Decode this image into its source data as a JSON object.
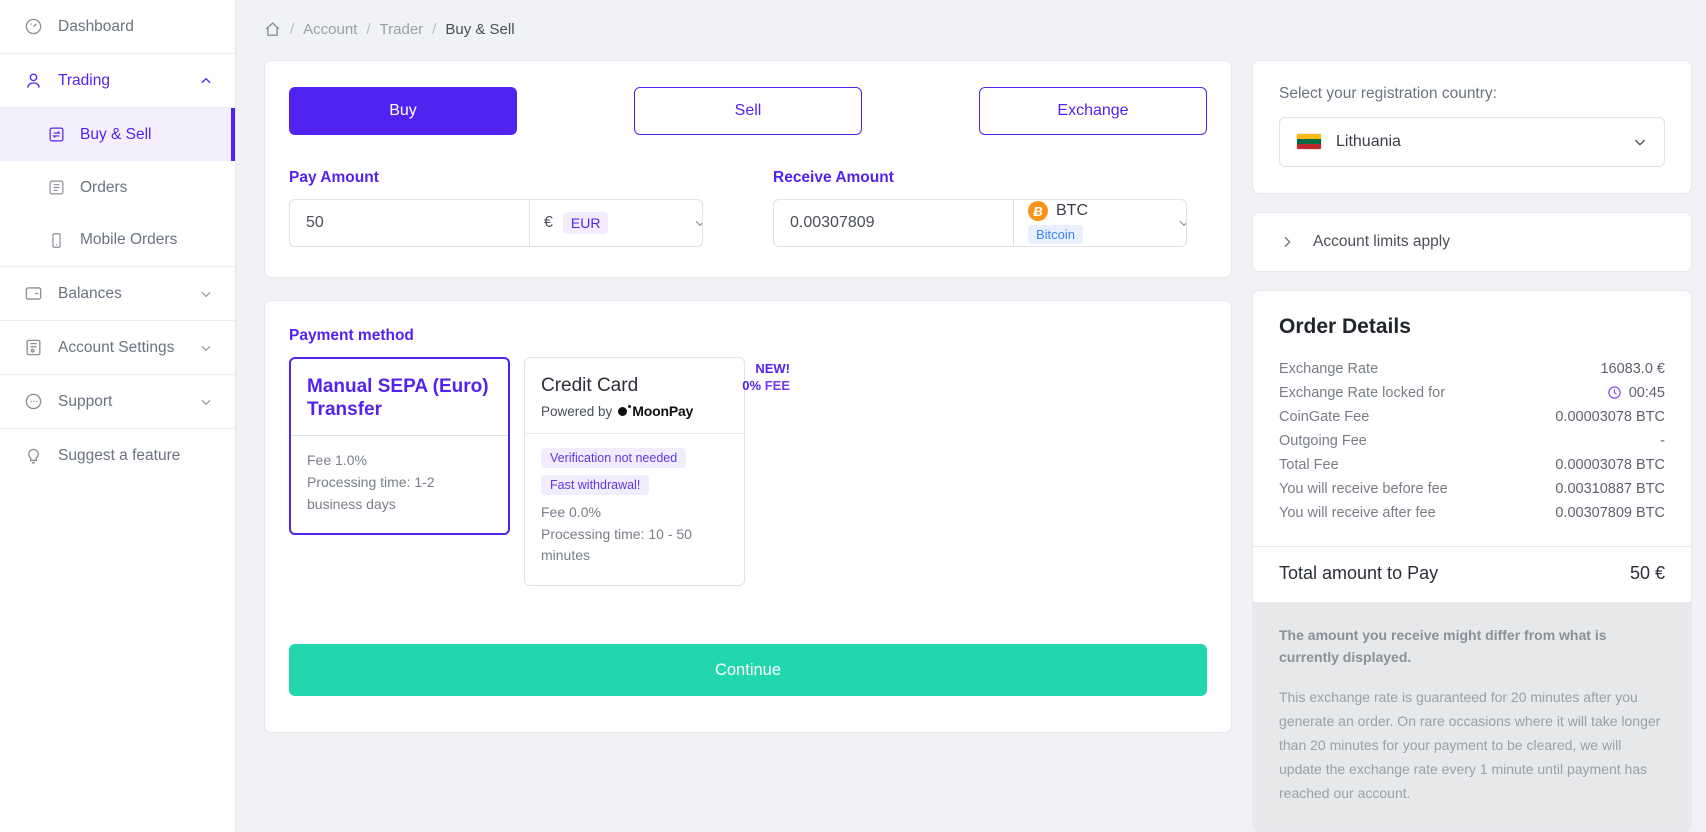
{
  "sidebar": {
    "items": [
      {
        "label": "Dashboard",
        "icon": "gauge-icon",
        "type": "link"
      },
      {
        "label": "Trading",
        "icon": "user-icon",
        "type": "group",
        "expanded": true,
        "chevron": "chevron-up-icon"
      },
      {
        "label": "Balances",
        "icon": "wallet-icon",
        "type": "group",
        "expanded": false,
        "chevron": "chevron-down-icon"
      },
      {
        "label": "Account Settings",
        "icon": "account-settings-icon",
        "type": "group",
        "expanded": false,
        "chevron": "chevron-down-icon"
      },
      {
        "label": "Support",
        "icon": "chat-icon",
        "type": "group",
        "expanded": false,
        "chevron": "chevron-down-icon"
      },
      {
        "label": "Suggest a feature",
        "icon": "lightbulb-icon",
        "type": "link"
      }
    ],
    "trading_children": [
      {
        "label": "Buy & Sell",
        "icon": "exchange-box-icon",
        "selected": true
      },
      {
        "label": "Orders",
        "icon": "list-box-icon",
        "selected": false
      },
      {
        "label": "Mobile Orders",
        "icon": "mobile-icon",
        "selected": false
      }
    ]
  },
  "breadcrumb": {
    "home_icon": "home-icon",
    "items": [
      "Account",
      "Trader",
      "Buy & Sell"
    ],
    "separator": "/"
  },
  "trade": {
    "tabs": [
      {
        "label": "Buy",
        "active": true
      },
      {
        "label": "Sell",
        "active": false
      },
      {
        "label": "Exchange",
        "active": false
      }
    ],
    "pay": {
      "label": "Pay Amount",
      "value": "50",
      "placeholder": "0",
      "currency_symbol": "€",
      "currency_code": "EUR",
      "caret": "chevron-down-icon"
    },
    "receive": {
      "label": "Receive Amount",
      "value": "0.00307809",
      "placeholder": "0",
      "coin_ticker": "BTC",
      "coin_name": "Bitcoin",
      "coin_symbol": "Ƀ",
      "caret": "chevron-down-icon"
    }
  },
  "payment": {
    "label": "Payment method",
    "methods": [
      {
        "title": "Manual SEPA (Euro) Transfer",
        "selected": true,
        "tags": [],
        "lines": [
          "Fee 1.0%",
          "Processing time: 1-2 business days"
        ]
      },
      {
        "title": "Credit Card",
        "selected": false,
        "powered_by": "Powered by",
        "provider": "MoonPay",
        "ribbon_new": "NEW!",
        "ribbon_pct": "0%",
        "ribbon_fee": "FEE",
        "tags": [
          "Verification not needed",
          "Fast withdrawal!"
        ],
        "lines": [
          "Fee 0.0%",
          "Processing time:  10 - 50 minutes"
        ]
      }
    ],
    "continue_label": "Continue"
  },
  "country": {
    "label": "Select your registration country:",
    "selected": "Lithuania",
    "flag": "lithuania-flag-icon",
    "caret": "chevron-down-icon"
  },
  "limits": {
    "label": "Account limits apply",
    "arrow": "chevron-right-icon"
  },
  "order": {
    "title": "Order Details",
    "rows": [
      {
        "label": "Exchange Rate",
        "value": "16083.0 €",
        "icon": null
      },
      {
        "label": "Exchange Rate locked for",
        "value": "00:45",
        "icon": "clock-icon"
      },
      {
        "label": "CoinGate Fee",
        "value": "0.00003078 BTC",
        "icon": null
      },
      {
        "label": "Outgoing Fee",
        "value": "-",
        "icon": null
      },
      {
        "label": "Total Fee",
        "value": "0.00003078 BTC",
        "icon": null
      },
      {
        "label": "You will receive before fee",
        "value": "0.00310887 BTC",
        "icon": null
      },
      {
        "label": "You will receive after fee",
        "value": "0.00307809 BTC",
        "icon": null
      }
    ],
    "total_label": "Total amount to Pay",
    "total_value": "50 €",
    "disclaimer_strong": "The amount you receive might differ from what is currently displayed.",
    "disclaimer_body": "This exchange rate is guaranteed for 20 minutes after you generate an order. On rare occasions where it will take longer than 20 minutes for your payment to be cleared, we will update the exchange rate every 1 minute until payment has reached our account."
  },
  "colors": {
    "accent": "#5223f0",
    "success": "#22d6ae",
    "bitcoin": "#f7931a",
    "page_bg": "#f1f2f6"
  }
}
